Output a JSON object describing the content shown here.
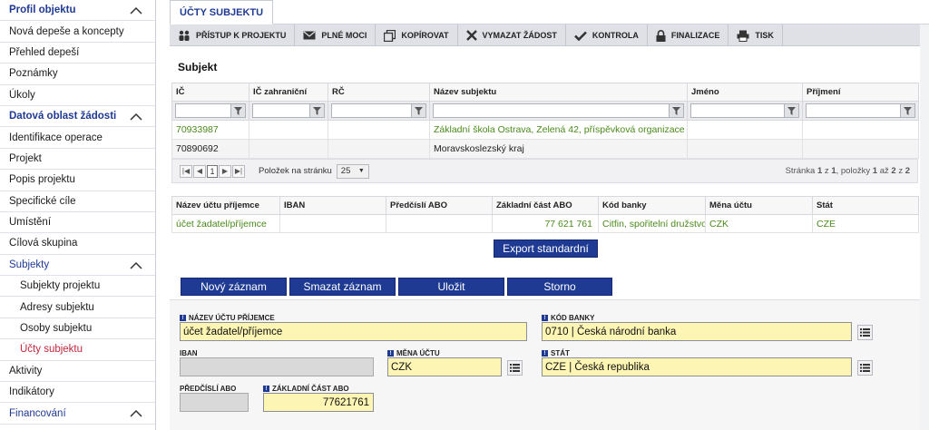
{
  "sidebar": {
    "sections": [
      {
        "label": "Profil objektu",
        "type": "head",
        "chevron": true
      },
      {
        "label": "Nová depeše a koncepty",
        "type": "item"
      },
      {
        "label": "Přehled depeší",
        "type": "item"
      },
      {
        "label": "Poznámky",
        "type": "item"
      },
      {
        "label": "Úkoly",
        "type": "item"
      },
      {
        "label": "Datová oblast žádosti",
        "type": "head",
        "chevron": true
      },
      {
        "label": "Identifikace operace",
        "type": "item"
      },
      {
        "label": "Projekt",
        "type": "item"
      },
      {
        "label": "Popis projektu",
        "type": "item"
      },
      {
        "label": "Specifické cíle",
        "type": "item"
      },
      {
        "label": "Umístění",
        "type": "item"
      },
      {
        "label": "Cílová skupina",
        "type": "item"
      },
      {
        "label": "Subjekty",
        "type": "blue",
        "chevron": true
      },
      {
        "label": "Subjekty projektu",
        "type": "sub"
      },
      {
        "label": "Adresy subjektu",
        "type": "sub"
      },
      {
        "label": "Osoby subjektu",
        "type": "sub"
      },
      {
        "label": "Účty subjektu",
        "type": "active"
      },
      {
        "label": "Aktivity",
        "type": "item"
      },
      {
        "label": "Indikátory",
        "type": "item"
      },
      {
        "label": "Financování",
        "type": "blue",
        "chevron": true
      }
    ]
  },
  "tab": {
    "label": "ÚČTY SUBJEKTU"
  },
  "toolbar": {
    "items": [
      {
        "label": "PŘÍSTUP K PROJEKTU",
        "icon": "people-icon"
      },
      {
        "label": "PLNÉ MOCI",
        "icon": "envelope-icon"
      },
      {
        "label": "KOPÍROVAT",
        "icon": "copy-icon"
      },
      {
        "label": "VYMAZAT ŽÁDOST",
        "icon": "cross-icon"
      },
      {
        "label": "KONTROLA",
        "icon": "check-icon"
      },
      {
        "label": "FINALIZACE",
        "icon": "lock-icon"
      },
      {
        "label": "TISK",
        "icon": "printer-icon"
      }
    ]
  },
  "subject": {
    "title": "Subjekt",
    "columns": [
      "IČ",
      "IČ zahraniční",
      "RČ",
      "Název subjektu",
      "Jméno",
      "Příjmení"
    ],
    "rows": [
      {
        "ic": "70933987",
        "ic_zahr": "",
        "rc": "",
        "nazev": "Základní škola Ostrava, Zelená 42, příspěvková organizace",
        "jmeno": "",
        "prijmeni": "",
        "highlight": true
      },
      {
        "ic": "70890692",
        "ic_zahr": "",
        "rc": "",
        "nazev": "Moravskoslezský kraj",
        "jmeno": "",
        "prijmeni": "",
        "highlight": false
      }
    ],
    "pager": {
      "current_page": "1",
      "per_page_label": "Položek na stránku",
      "per_page": "25",
      "info_pre": "Stránka",
      "page": "1",
      "of": "z",
      "pages": "1",
      "items_label": ", položky",
      "from": "1",
      "to_label": "až",
      "to": "2",
      "total": "2"
    }
  },
  "accounts": {
    "columns": [
      "Název účtu příjemce",
      "IBAN",
      "Předčíslí ABO",
      "Základní část ABO",
      "Kód banky",
      "Měna účtu",
      "Stát"
    ],
    "rows": [
      {
        "nazev": "účet žadatel/příjemce",
        "iban": "",
        "predcisli": "",
        "zakladni": "77 621 761",
        "banka": "Citfin, spořitelní družstvo",
        "mena": "CZK",
        "stat": "CZE"
      }
    ],
    "export_label": "Export standardní"
  },
  "actions": {
    "new": "Nový záznam",
    "delete": "Smazat záznam",
    "save": "Uložit",
    "cancel": "Storno"
  },
  "form": {
    "nazev_label": "NÁZEV ÚČTU PŘÍJEMCE",
    "nazev_value": "účet žadatel/příjemce",
    "kod_banky_label": "KÓD BANKY",
    "kod_banky_value": "0710 | Česká národní banka",
    "iban_label": "IBAN",
    "iban_value": "",
    "mena_label": "MĚNA ÚČTU",
    "mena_value": "CZK",
    "stat_label": "STÁT",
    "stat_value": "CZE | Česká republika",
    "predcisli_label": "PŘEDČÍSLÍ ABO",
    "predcisli_value": "",
    "zakladni_label": "ZÁKLADNÍ ČÁST ABO",
    "zakladni_value": "77621761",
    "req_marker": "!"
  },
  "colors": {
    "primary": "#1f3a93",
    "active": "#c0263a",
    "green": "#4a8a1a",
    "field": "#fdf5b3"
  }
}
